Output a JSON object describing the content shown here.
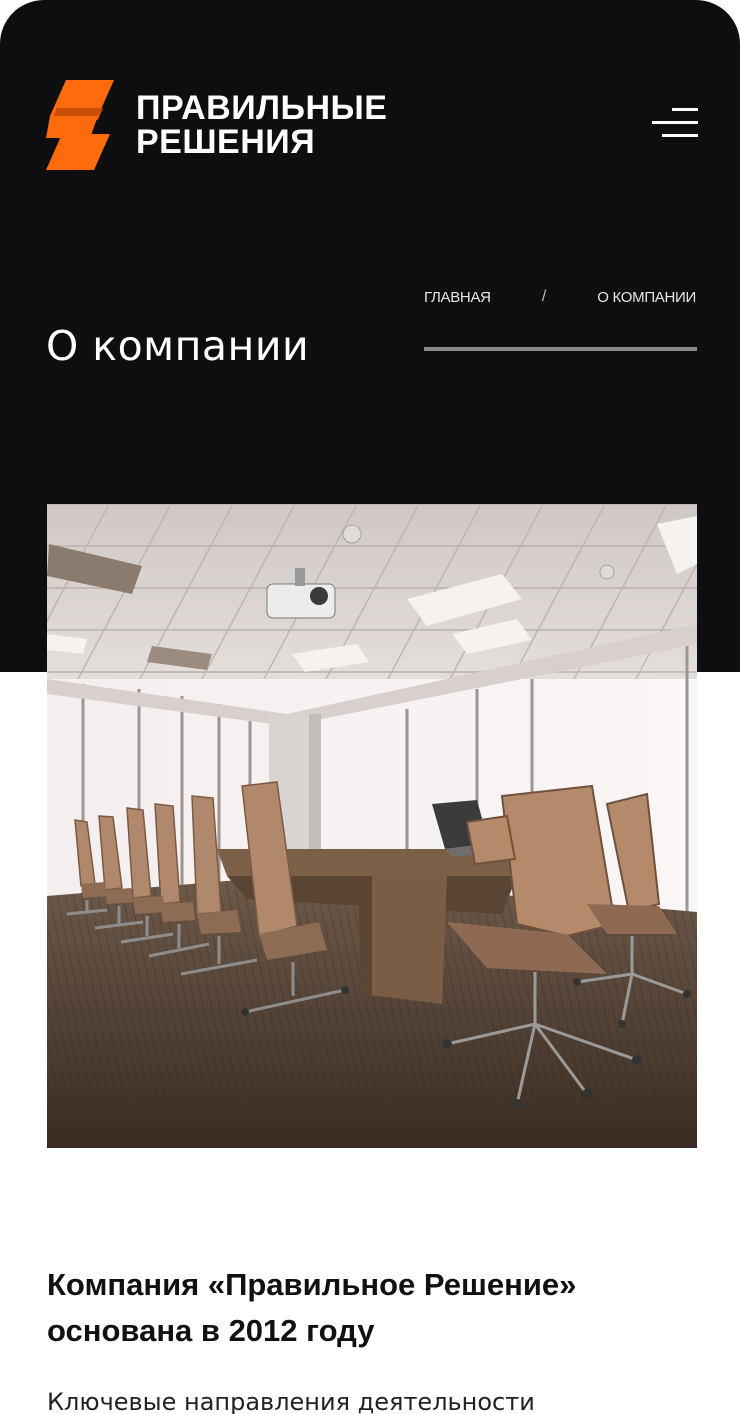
{
  "header": {
    "logo_line1": "ПРАВИЛЬНЫЕ",
    "logo_line2": "РЕШЕНИЯ",
    "accent_color": "#ff6a0d",
    "background_color": "#0e0e10",
    "menu_icon": "hamburger-menu-icon"
  },
  "breadcrumb": {
    "home": "ГЛАВНАЯ",
    "separator": "/",
    "current": "О КОМПАНИИ"
  },
  "page": {
    "title": "О компании"
  },
  "content": {
    "image_subject": "conference-room-photo",
    "headline": "Компания «Правильное Решение» основана в 2012 году",
    "subhead": "Ключевые направления деятельности"
  }
}
